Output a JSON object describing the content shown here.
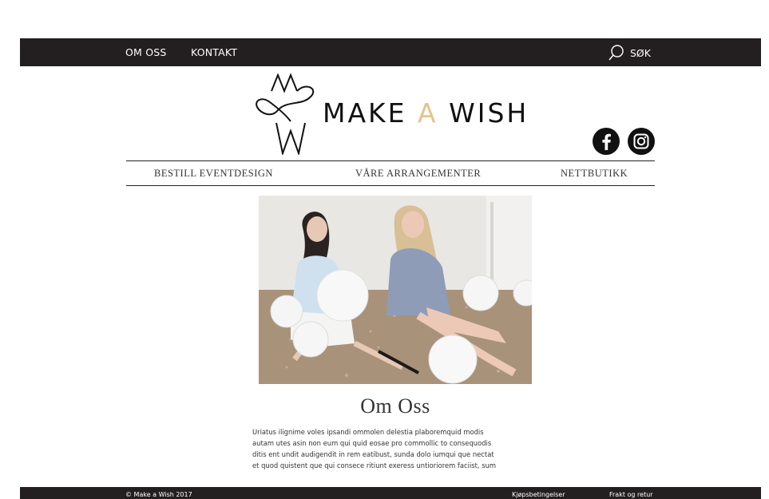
{
  "topbar": {
    "links": [
      "OM OSS",
      "KONTAKT"
    ],
    "search_label": "SØK"
  },
  "brand": {
    "text_before": "MAKE",
    "accent_word": "A",
    "text_after": "WISH",
    "accent_color": "#e6c38c"
  },
  "social": [
    "facebook-icon",
    "instagram-icon"
  ],
  "nav": [
    "BESTILL EVENTDESIGN",
    "VÅRE ARRANGEMENTER",
    "NETTBUTIKK"
  ],
  "main": {
    "title": "Om Oss",
    "body_lines": [
      "Uriatus ilignime voles ipsandi ommolen delestia plaboremquid modis",
      "autam utes asin non eum qui quid eosae pro commollic to consequodis",
      "ditis ent undit audigendit in rem eatibust, sunda dolo iumqui que nectat",
      "et quod quistent que qui consece ritiunt exeress untioriorem faciist, sum"
    ]
  },
  "footer": {
    "copyright": "© Make a Wish 2017",
    "links": [
      "Kjøpsbetingelser",
      "Frakt og retur"
    ]
  }
}
